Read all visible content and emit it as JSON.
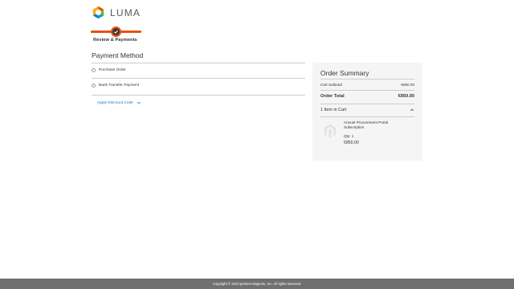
{
  "header": {
    "logo_text": "LUMA",
    "logo_icon": "luma-logo-icon"
  },
  "progress": {
    "step_label": "Review & Payments",
    "step_state": "current",
    "icon": "checkmark-icon",
    "accent_color": "#e8510c"
  },
  "payment": {
    "title": "Payment Method",
    "options": [
      {
        "label": "Purchase Order",
        "selected": false
      },
      {
        "label": "Bank Transfer Payment",
        "selected": false
      }
    ],
    "discount_label": "Apply Discount Code",
    "discount_icon": "chevron-down-icon",
    "link_color": "#1979c3"
  },
  "summary": {
    "title": "Order Summary",
    "subtotal_label": "Cart Subtotal",
    "subtotal_value": "€850.00",
    "total_label": "Order Total",
    "total_value": "€850.00",
    "cart_label": "1 Item in Cart",
    "cart_icon": "chevron-up-icon",
    "item": {
      "name": "Annual Procurement Portal Subscription",
      "qty_label": "Qty: 1",
      "price": "€850.00",
      "thumbnail_icon": "magento-placeholder-icon"
    },
    "background": "#f5f5f5"
  },
  "footer": {
    "copyright": "Copyright © 2013-present Magento, Inc. All rights reserved.",
    "background": "#6e716e"
  }
}
